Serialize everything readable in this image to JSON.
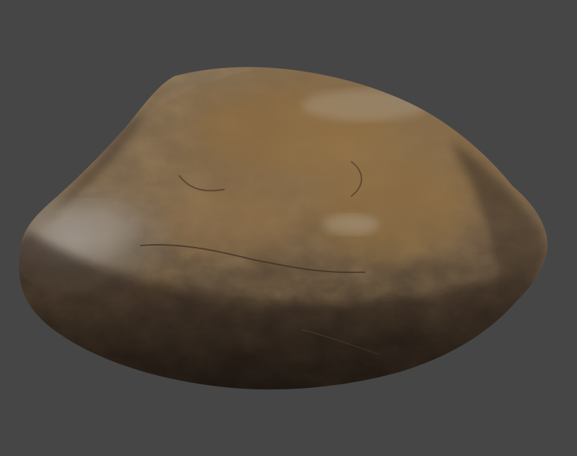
{
  "scene": {
    "background_color": "#464646",
    "object": "rock"
  },
  "colors": {
    "rock_dark": "#1c1712",
    "rock_mid": "#6b5a44",
    "rock_brown": "#8a6a42",
    "rock_grey": "#8e8a86",
    "rock_highlight": "#c9c3bb"
  }
}
